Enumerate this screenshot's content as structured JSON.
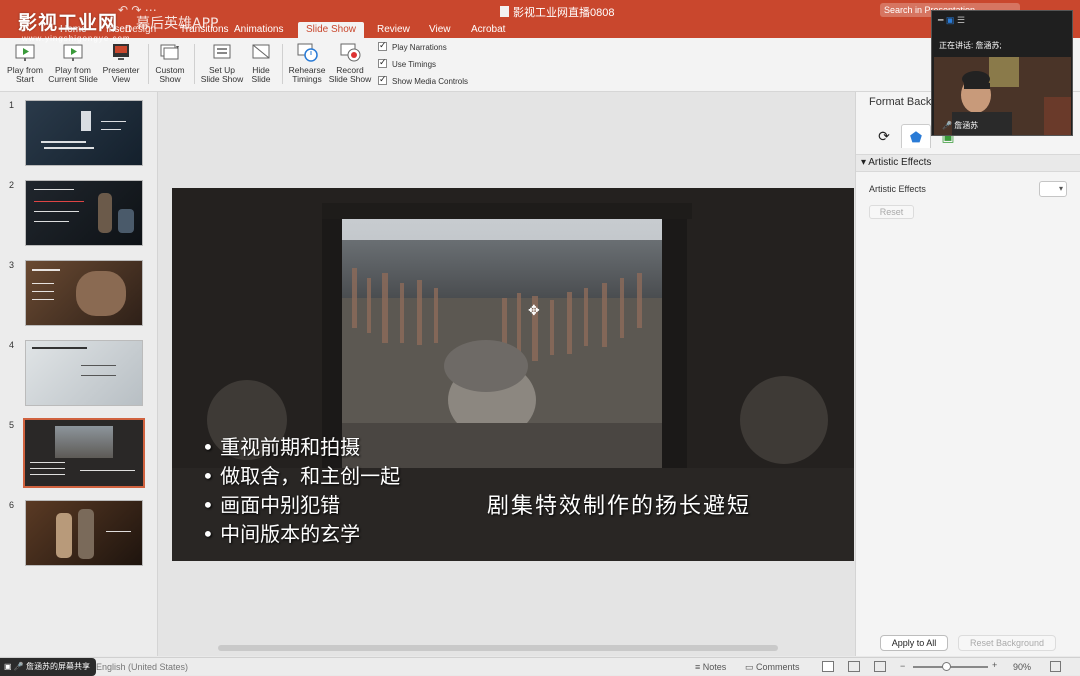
{
  "window": {
    "watermark_logo": "影视工业网",
    "watermark_app": "幕后英雄APP",
    "watermark_url": "www.yingshigongye.com",
    "doc_title": "影视工业网直播0808",
    "search_placeholder": "Search in Presentation"
  },
  "tabs": [
    "Home",
    "Insert",
    "Design",
    "Transitions",
    "Animations",
    "Slide Show",
    "Review",
    "View",
    "Acrobat"
  ],
  "active_tab": "Slide Show",
  "ribbon": {
    "play_from_start": "Play from\nStart",
    "play_from_current": "Play from\nCurrent Slide",
    "presenter_view": "Presenter\nView",
    "custom_show": "Custom\nShow",
    "set_up_slide_show": "Set Up\nSlide Show",
    "hide_slide": "Hide\nSlide",
    "rehearse_timings": "Rehearse\nTimings",
    "record_slide_show": "Record\nSlide Show",
    "play_narrations": "Play Narrations",
    "use_timings": "Use Timings",
    "show_media_controls": "Show Media Controls"
  },
  "thumbnails": [
    {
      "num": "1"
    },
    {
      "num": "2"
    },
    {
      "num": "3"
    },
    {
      "num": "4"
    },
    {
      "num": "5"
    },
    {
      "num": "6"
    }
  ],
  "selected_slide": "5",
  "slide": {
    "bullets": [
      "重视前期和拍摄",
      "做取舍，和主创一起",
      "画面中别犯错",
      "中间版本的玄学"
    ],
    "title": "剧集特效制作的扬长避短"
  },
  "format_pane": {
    "title": "Format Background",
    "section": "Artistic Effects",
    "label": "Artistic Effects",
    "reset": "Reset",
    "apply_all": "Apply to All",
    "reset_background": "Reset Background"
  },
  "video": {
    "speaking_label": "正在讲话: 詹涵苏;",
    "participant_name": "詹涵苏"
  },
  "status": {
    "share_label": "詹涵苏的屏幕共享",
    "language": "English (United States)",
    "notes": "Notes",
    "comments": "Comments",
    "zoom": "90%"
  },
  "colors": {
    "ribbon_accent": "#c9472d",
    "selected_border": "#d0623f"
  }
}
